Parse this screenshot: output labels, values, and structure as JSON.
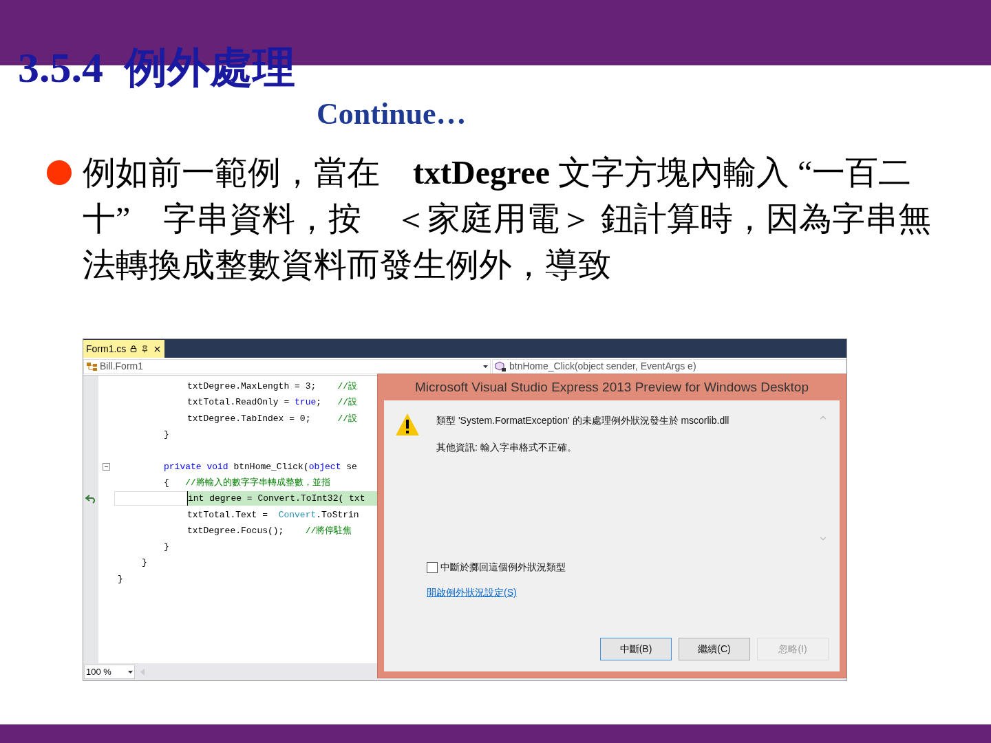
{
  "slide": {
    "title": "3.5.4  例外處理",
    "subtitle": "Continue…",
    "bullets": [
      {
        "text": "例如前一範例，當在　**txtDegree** 文字方塊內輸入 “一百二十”　字串資料，按　＜家庭用電＞ 鈕計算時，因為字串無法轉換成整數資料而發生例外，導致"
      }
    ]
  },
  "screenshot": {
    "tab": {
      "label": "Form1.cs",
      "selected": true
    },
    "class_dropdown": "Bill.Form1",
    "member_dropdown": "btnHome_Click(object sender, EventArgs e)",
    "code_lines": [
      {
        "kind": "body",
        "current": false,
        "collapse": false,
        "tokens": [
          {
            "kind": "plain",
            "text": "txtDegree.MaxLength = 3;    "
          },
          {
            "kind": "comment",
            "text": "//設"
          }
        ]
      },
      {
        "kind": "body",
        "current": false,
        "collapse": false,
        "tokens": [
          {
            "kind": "plain",
            "text": "txtTotal.ReadOnly = "
          },
          {
            "kind": "keyword",
            "text": "true"
          },
          {
            "kind": "plain",
            "text": ";   "
          },
          {
            "kind": "comment",
            "text": "//設"
          }
        ]
      },
      {
        "kind": "body",
        "current": false,
        "collapse": false,
        "tokens": [
          {
            "kind": "plain",
            "text": "txtDegree.TabIndex = 0;     "
          },
          {
            "kind": "comment",
            "text": "//設"
          }
        ]
      },
      {
        "kind": "method",
        "current": false,
        "collapse": false,
        "tokens": [
          {
            "kind": "plain",
            "text": "}"
          }
        ]
      },
      {
        "kind": "method",
        "current": false,
        "collapse": false
      },
      {
        "kind": "method",
        "current": false,
        "collapse": true,
        "tokens": [
          {
            "kind": "keyword",
            "text": "private void"
          },
          {
            "kind": "plain",
            "text": " btnHome_Click("
          },
          {
            "kind": "keyword",
            "text": "object"
          },
          {
            "kind": "plain",
            "text": " se"
          }
        ]
      },
      {
        "kind": "method",
        "current": false,
        "collapse": false,
        "tokens": [
          {
            "kind": "plain",
            "text": "{   "
          },
          {
            "kind": "comment",
            "text": "//將輸入的數字字串轉成整數，並指"
          }
        ]
      },
      {
        "kind": "body",
        "current": true,
        "collapse": false,
        "tokens": [
          {
            "kind": "plain",
            "text": "int degree = Convert.ToInt32( txt"
          }
        ]
      },
      {
        "kind": "body",
        "current": false,
        "collapse": false,
        "tokens": [
          {
            "kind": "plain",
            "text": "txtTotal.Text =  "
          },
          {
            "kind": "type",
            "text": "Convert"
          },
          {
            "kind": "plain",
            "text": ".ToStrin"
          }
        ]
      },
      {
        "kind": "body",
        "current": false,
        "collapse": false,
        "tokens": [
          {
            "kind": "plain",
            "text": "txtDegree.Focus();    "
          },
          {
            "kind": "comment",
            "text": "//將停駐焦"
          }
        ]
      },
      {
        "kind": "method",
        "current": false,
        "collapse": false,
        "tokens": [
          {
            "kind": "plain",
            "text": "}"
          }
        ]
      },
      {
        "kind": "class",
        "current": false,
        "collapse": false,
        "tokens": [
          {
            "kind": "plain",
            "text": "}"
          }
        ]
      },
      {
        "kind": "namespace",
        "current": false,
        "collapse": false,
        "tokens": [
          {
            "kind": "plain",
            "text": "}"
          }
        ]
      }
    ],
    "zoom": "100 %",
    "dialog": {
      "title": "Microsoft Visual Studio Express 2013 Preview for Windows Desktop",
      "message": "類型 'System.FormatException' 的未處理例外狀況發生於 mscorlib.dll",
      "detail": "其他資訊: 輸入字串格式不正確。",
      "checkbox": {
        "label": "中斷於擲回這個例外狀況類型",
        "checked": false
      },
      "link": "開啟例外狀況設定(S)",
      "buttons": [
        {
          "label": "中斷(B)",
          "selected": true,
          "disabled": false
        },
        {
          "label": "繼續(C)",
          "selected": false,
          "disabled": false
        },
        {
          "label": "忽略(I)",
          "selected": false,
          "disabled": true
        }
      ]
    }
  }
}
